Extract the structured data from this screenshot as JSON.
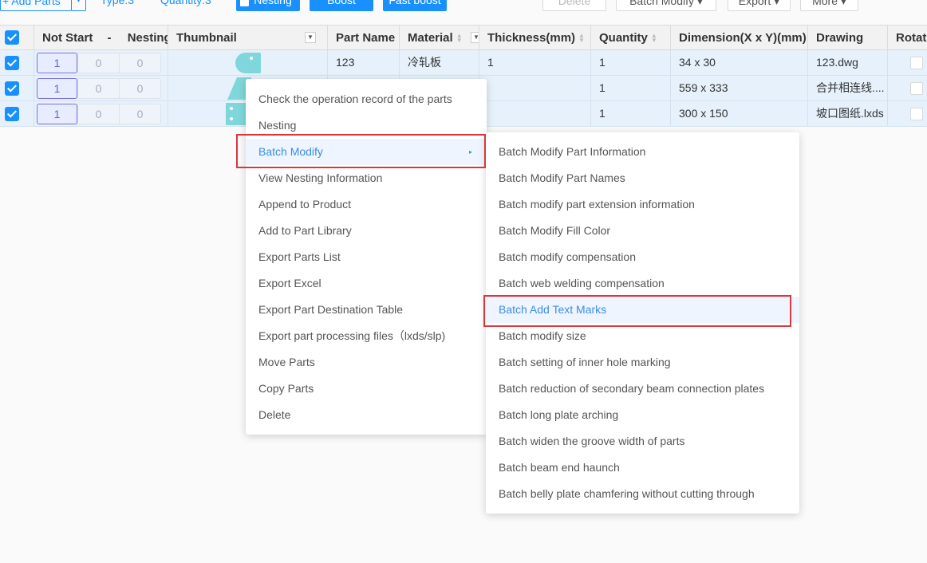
{
  "toolbar": {
    "add_parts": "+ Add Parts",
    "add_parts_dropdown": "▾",
    "type": "Type:3",
    "quantity": "Quantity:3",
    "nesting": "Nesting",
    "boost": "Boost",
    "fast_boost": "Fast boost",
    "delete": "Delete",
    "batch_modify": "Batch Modify ▾",
    "export": "Export ▾",
    "more": "More ▾"
  },
  "table": {
    "headers": {
      "not_start": "Not Start",
      "dash": "-",
      "nesting": "Nesting",
      "thumbnail": "Thumbnail",
      "part_name": "Part Name",
      "material": "Material",
      "thickness": "Thickness(mm)",
      "quantity": "Quantity",
      "dimension": "Dimension(X x Y)(mm)",
      "drawing": "Drawing",
      "rotate": "Rotat"
    },
    "rows": [
      {
        "s1": "1",
        "s2": "0",
        "s3": "0",
        "part_name": "123",
        "material": "冷轧板",
        "thickness": "1",
        "quantity": "1",
        "dimension": "34 x 30",
        "drawing": "123.dwg"
      },
      {
        "s1": "1",
        "s2": "0",
        "s3": "0",
        "part_name": "",
        "material": "",
        "thickness": "",
        "quantity": "1",
        "dimension": "559 x 333",
        "drawing": "合并相连线...."
      },
      {
        "s1": "1",
        "s2": "0",
        "s3": "0",
        "part_name": "",
        "material": "",
        "thickness": "",
        "quantity": "1",
        "dimension": "300 x 150",
        "drawing": "坡口图纸.lxds"
      }
    ]
  },
  "context_menu": {
    "items": [
      "Check the operation record of the parts",
      "Nesting",
      "Batch Modify",
      "View Nesting Information",
      "Append to Product",
      "Add to Part Library",
      "Export Parts List",
      "Export Excel",
      "Export Part Destination Table",
      "Export part processing files（lxds/slp)",
      "Move Parts",
      "Copy Parts",
      "Delete"
    ],
    "submenu_arrow": "▸"
  },
  "submenu": {
    "items": [
      "Batch Modify Part Information",
      "Batch Modify Part Names",
      "Batch modify part extension information",
      "Batch Modify Fill Color",
      "Batch modify compensation",
      "Batch web welding compensation",
      "Batch Add Text Marks",
      "Batch modify size",
      "Batch setting of inner hole marking",
      "Batch reduction of secondary beam connection plates",
      "Batch long plate arching",
      "Batch widen the groove width of parts",
      "Batch beam end haunch",
      "Batch belly plate chamfering without cutting through"
    ]
  },
  "colors": {
    "primary": "#1890ff",
    "row_selected": "#e6f1fb",
    "highlight_text": "#3a8ee6",
    "annotation_red": "#d9363e",
    "thumbnail_fill": "#7fd6db"
  }
}
